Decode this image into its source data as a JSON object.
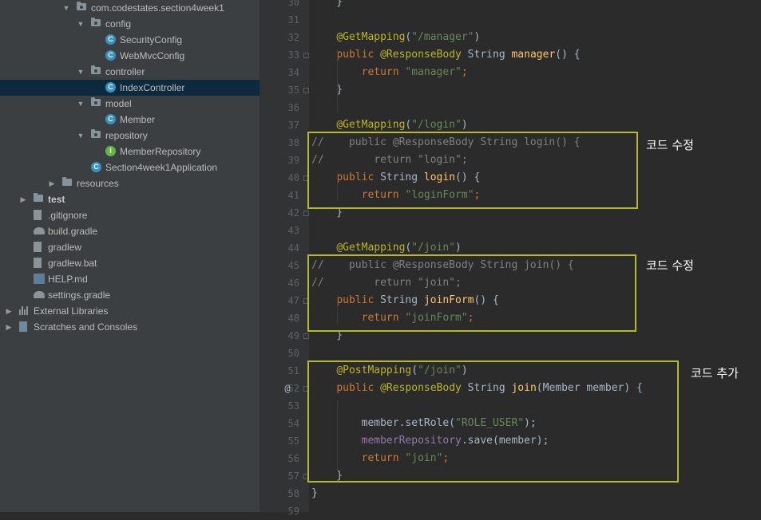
{
  "project_tree": [
    {
      "label": "com.codestates.section4week1",
      "depth": 0,
      "type": "package",
      "expanded": true
    },
    {
      "label": "config",
      "depth": 1,
      "type": "package",
      "expanded": true
    },
    {
      "label": "SecurityConfig",
      "depth": 2,
      "type": "class"
    },
    {
      "label": "WebMvcConfig",
      "depth": 2,
      "type": "class"
    },
    {
      "label": "controller",
      "depth": 1,
      "type": "package",
      "expanded": true
    },
    {
      "label": "IndexController",
      "depth": 2,
      "type": "class",
      "selected": true
    },
    {
      "label": "model",
      "depth": 1,
      "type": "package",
      "expanded": true
    },
    {
      "label": "Member",
      "depth": 2,
      "type": "class"
    },
    {
      "label": "repository",
      "depth": 1,
      "type": "package",
      "expanded": true
    },
    {
      "label": "MemberRepository",
      "depth": 2,
      "type": "interface"
    },
    {
      "label": "Section4week1Application",
      "depth": 1,
      "type": "app-class"
    },
    {
      "label": "resources",
      "depth": 0,
      "type": "resources-folder",
      "expanded": false
    },
    {
      "label": "test",
      "depth": -1,
      "type": "folder",
      "expanded": false,
      "bold": true
    },
    {
      "label": ".gitignore",
      "depth": -1,
      "type": "file"
    },
    {
      "label": "build.gradle",
      "depth": -1,
      "type": "gradle"
    },
    {
      "label": "gradlew",
      "depth": -1,
      "type": "file"
    },
    {
      "label": "gradlew.bat",
      "depth": -1,
      "type": "file"
    },
    {
      "label": "HELP.md",
      "depth": -1,
      "type": "md"
    },
    {
      "label": "settings.gradle",
      "depth": -1,
      "type": "gradle"
    },
    {
      "label": "External Libraries",
      "depth": -2,
      "type": "libraries",
      "expanded": false
    },
    {
      "label": "Scratches and Consoles",
      "depth": -2,
      "type": "scratches",
      "expanded": false
    }
  ],
  "code_lines": [
    {
      "n": "30",
      "tokens": [
        {
          "t": "    }",
          "c": ""
        }
      ]
    },
    {
      "n": "31",
      "tokens": []
    },
    {
      "n": "32",
      "tokens": [
        {
          "t": "    ",
          "c": ""
        },
        {
          "t": "@GetMapping",
          "c": "ann"
        },
        {
          "t": "(",
          "c": ""
        },
        {
          "t": "\"/manager\"",
          "c": "str"
        },
        {
          "t": ")",
          "c": ""
        }
      ]
    },
    {
      "n": "33",
      "tokens": [
        {
          "t": "    ",
          "c": ""
        },
        {
          "t": "public ",
          "c": "kw"
        },
        {
          "t": "@ResponseBody",
          "c": "ann"
        },
        {
          "t": " String ",
          "c": ""
        },
        {
          "t": "manager",
          "c": "fn"
        },
        {
          "t": "() {",
          "c": ""
        }
      ]
    },
    {
      "n": "34",
      "tokens": [
        {
          "t": "        ",
          "c": ""
        },
        {
          "t": "return ",
          "c": "kw"
        },
        {
          "t": "\"manager\"",
          "c": "str"
        },
        {
          "t": ";",
          "c": "kw"
        }
      ]
    },
    {
      "n": "35",
      "tokens": [
        {
          "t": "    }",
          "c": ""
        }
      ]
    },
    {
      "n": "36",
      "tokens": []
    },
    {
      "n": "37",
      "tokens": [
        {
          "t": "    ",
          "c": ""
        },
        {
          "t": "@GetMapping",
          "c": "ann"
        },
        {
          "t": "(",
          "c": ""
        },
        {
          "t": "\"/login\"",
          "c": "str"
        },
        {
          "t": ")",
          "c": ""
        }
      ]
    },
    {
      "n": "38",
      "tokens": [
        {
          "t": "//    public @ResponseBody String login() {",
          "c": "cmt"
        }
      ]
    },
    {
      "n": "39",
      "tokens": [
        {
          "t": "//        return \"login\";",
          "c": "cmt"
        }
      ]
    },
    {
      "n": "40",
      "tokens": [
        {
          "t": "    ",
          "c": ""
        },
        {
          "t": "public ",
          "c": "kw"
        },
        {
          "t": "String ",
          "c": ""
        },
        {
          "t": "login",
          "c": "fn"
        },
        {
          "t": "() {",
          "c": ""
        }
      ]
    },
    {
      "n": "41",
      "tokens": [
        {
          "t": "        ",
          "c": ""
        },
        {
          "t": "return ",
          "c": "kw"
        },
        {
          "t": "\"loginForm\"",
          "c": "str"
        },
        {
          "t": ";",
          "c": "kw"
        }
      ]
    },
    {
      "n": "42",
      "tokens": [
        {
          "t": "    }",
          "c": ""
        }
      ]
    },
    {
      "n": "43",
      "tokens": []
    },
    {
      "n": "44",
      "tokens": [
        {
          "t": "    ",
          "c": ""
        },
        {
          "t": "@GetMapping",
          "c": "ann"
        },
        {
          "t": "(",
          "c": ""
        },
        {
          "t": "\"/join\"",
          "c": "str"
        },
        {
          "t": ")",
          "c": ""
        }
      ]
    },
    {
      "n": "45",
      "tokens": [
        {
          "t": "//    public @ResponseBody String join() {",
          "c": "cmt"
        }
      ]
    },
    {
      "n": "46",
      "tokens": [
        {
          "t": "//        return \"join\";",
          "c": "cmt"
        }
      ]
    },
    {
      "n": "47",
      "tokens": [
        {
          "t": "    ",
          "c": ""
        },
        {
          "t": "public ",
          "c": "kw"
        },
        {
          "t": "String ",
          "c": ""
        },
        {
          "t": "joinForm",
          "c": "fn"
        },
        {
          "t": "() {",
          "c": ""
        }
      ]
    },
    {
      "n": "48",
      "tokens": [
        {
          "t": "        ",
          "c": ""
        },
        {
          "t": "return ",
          "c": "kw"
        },
        {
          "t": "\"joinForm\"",
          "c": "str"
        },
        {
          "t": ";",
          "c": "kw"
        }
      ]
    },
    {
      "n": "49",
      "tokens": [
        {
          "t": "    }",
          "c": ""
        }
      ]
    },
    {
      "n": "50",
      "tokens": []
    },
    {
      "n": "51",
      "tokens": [
        {
          "t": "    ",
          "c": ""
        },
        {
          "t": "@PostMapping",
          "c": "ann"
        },
        {
          "t": "(",
          "c": ""
        },
        {
          "t": "\"/join\"",
          "c": "str"
        },
        {
          "t": ")",
          "c": ""
        }
      ]
    },
    {
      "n": "52",
      "mark": "@",
      "tokens": [
        {
          "t": "    ",
          "c": ""
        },
        {
          "t": "public ",
          "c": "kw"
        },
        {
          "t": "@ResponseBody",
          "c": "ann"
        },
        {
          "t": " String ",
          "c": ""
        },
        {
          "t": "join",
          "c": "fn"
        },
        {
          "t": "(Member member) {",
          "c": ""
        }
      ]
    },
    {
      "n": "53",
      "tokens": []
    },
    {
      "n": "54",
      "tokens": [
        {
          "t": "        member.setRole(",
          "c": ""
        },
        {
          "t": "\"ROLE_USER\"",
          "c": "str"
        },
        {
          "t": ");",
          "c": ""
        }
      ]
    },
    {
      "n": "55",
      "tokens": [
        {
          "t": "        ",
          "c": ""
        },
        {
          "t": "memberRepository",
          "c": "fld"
        },
        {
          "t": ".save(member);",
          "c": ""
        }
      ]
    },
    {
      "n": "56",
      "tokens": [
        {
          "t": "        ",
          "c": ""
        },
        {
          "t": "return ",
          "c": "kw"
        },
        {
          "t": "\"join\"",
          "c": "str"
        },
        {
          "t": ";",
          "c": "kw"
        }
      ]
    },
    {
      "n": "57",
      "tokens": [
        {
          "t": "    }",
          "c": ""
        }
      ]
    },
    {
      "n": "58",
      "tokens": [
        {
          "t": "}",
          "c": ""
        }
      ]
    },
    {
      "n": "59",
      "tokens": []
    }
  ],
  "annotations": {
    "note_login": "코드 수정",
    "note_join": "코드 수정",
    "note_post": "코드 추가"
  },
  "colors": {
    "highlight_box": "#b6b92a",
    "annotation": "#bbb529",
    "keyword": "#cc7832",
    "string": "#6a8759",
    "function": "#ffc66d",
    "comment": "#808080"
  }
}
